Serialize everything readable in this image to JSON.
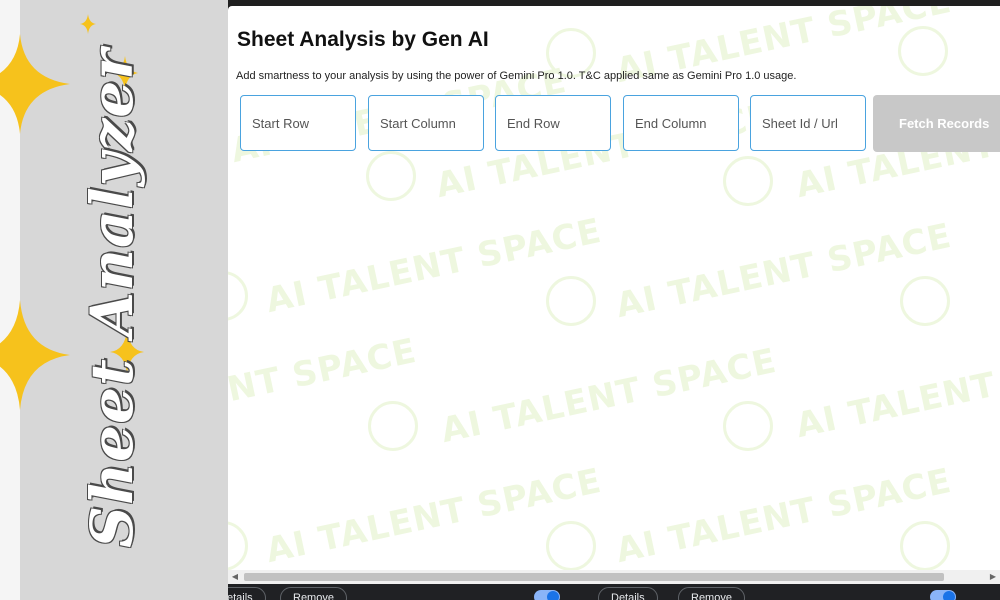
{
  "banner": {
    "title": "Sheet Analyzer",
    "accent_color": "#f6c21c"
  },
  "panel": {
    "title": "Sheet Analysis by Gen AI",
    "subtitle": "Add smartness to your analysis by using the power of Gemini Pro 1.0. T&C applied same as Gemini Pro 1.0 usage.",
    "fields": {
      "start_row": "Start Row",
      "start_column": "Start Column",
      "end_row": "End Row",
      "end_column": "End Column",
      "sheet_id": "Sheet Id / Url"
    },
    "fetch_button": "Fetch Records",
    "watermark": "AI TALENT SPACE"
  },
  "bottom_bar": {
    "details_left": "etails",
    "remove_left": "Remove",
    "details_right": "Details",
    "remove_right": "Remove"
  },
  "colors": {
    "field_border": "#4aa3df",
    "button_disabled": "#c8c8c8",
    "watermark": "#eef7df"
  }
}
